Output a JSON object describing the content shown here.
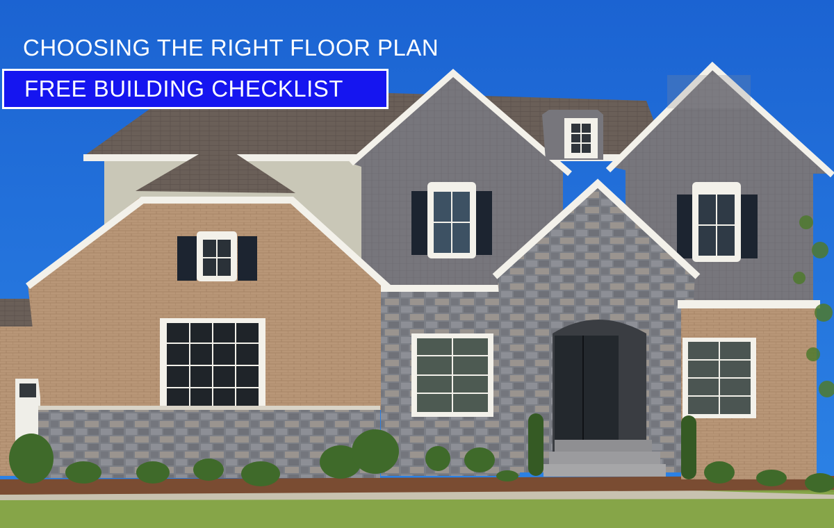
{
  "banner": {
    "headline": "CHOOSING THE RIGHT FLOOR PLAN",
    "badge_label": "FREE BUILDING CHECKLIST"
  },
  "photo": {
    "subject": "house-exterior"
  },
  "colors": {
    "sky": "#1f6fd8",
    "badge_fill": "#1515f0",
    "badge_border": "#ffffff",
    "text": "#ffffff"
  }
}
